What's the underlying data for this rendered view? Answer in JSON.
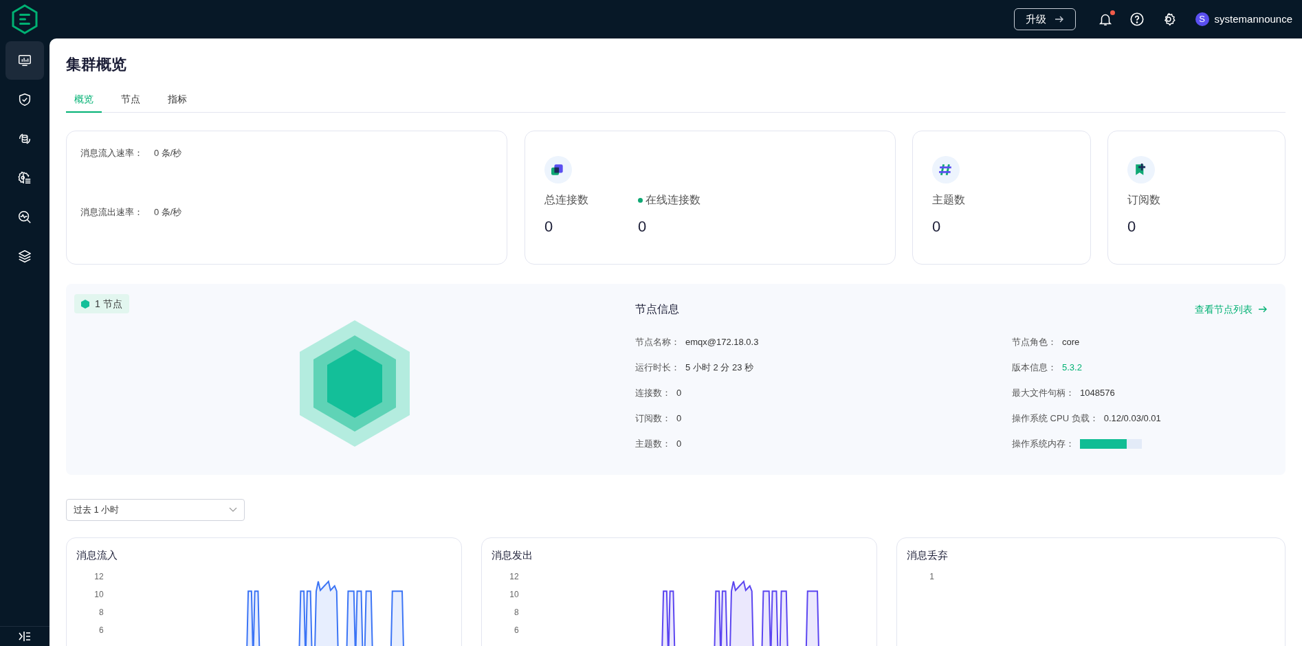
{
  "top_bar": {
    "upgrade_button": "升级",
    "notifications": {
      "unread": true
    },
    "user": {
      "avatar": "S",
      "name": "systemannounce"
    }
  },
  "sidebar": {
    "items": [
      {
        "kind": "monitor",
        "selected": true
      },
      {
        "kind": "shield",
        "selected": false
      },
      {
        "kind": "data",
        "selected": false
      },
      {
        "kind": "gear",
        "selected": false
      },
      {
        "kind": "analysis",
        "selected": false
      },
      {
        "kind": "layers",
        "selected": false
      }
    ]
  },
  "page_title": "集群概览",
  "tabs": [
    {
      "label": "概览",
      "selected": true
    },
    {
      "label": "节点",
      "selected": false
    },
    {
      "label": "指标",
      "selected": false
    }
  ],
  "rates": [
    {
      "label": "消息流入速率：",
      "value": "0 条/秒"
    },
    {
      "label": "消息流出速率：",
      "value": "0 条/秒"
    }
  ],
  "stat_cards": [
    {
      "kind": "connections",
      "metrics": [
        {
          "label": "总连接数",
          "value": "0",
          "dot": false
        },
        {
          "label": "在线连接数",
          "value": "0",
          "dot": true
        }
      ]
    },
    {
      "kind": "topics",
      "metrics": [
        {
          "label": "主题数",
          "value": "0",
          "dot": false
        }
      ]
    },
    {
      "kind": "subscriptions",
      "metrics": [
        {
          "label": "订阅数",
          "value": "0",
          "dot": false
        }
      ]
    }
  ],
  "node_panel": {
    "badge": "1 节点",
    "title": "节点信息",
    "link": "查看节点列表",
    "left_fields": [
      {
        "kind": "text",
        "label": "节点名称：",
        "value": "emqx@172.18.0.3"
      },
      {
        "kind": "text",
        "label": "运行时长：",
        "value": "5 小时 2 分 23 秒"
      },
      {
        "kind": "text",
        "label": "连接数：",
        "value": "0"
      },
      {
        "kind": "text",
        "label": "订阅数：",
        "value": "0"
      },
      {
        "kind": "text",
        "label": "主题数：",
        "value": "0"
      }
    ],
    "right_fields": [
      {
        "kind": "text",
        "label": "节点角色：",
        "value": "core"
      },
      {
        "kind": "version",
        "label": "版本信息：",
        "value": "5.3.2"
      },
      {
        "kind": "text",
        "label": "最大文件句柄：",
        "value": "1048576"
      },
      {
        "kind": "text",
        "label": "操作系统 CPU 负载：",
        "value": "0.12/0.03/0.01"
      },
      {
        "kind": "meter",
        "label": "操作系统内存：",
        "level": 0.76
      }
    ]
  },
  "time_range": {
    "value": "过去 1 小时"
  },
  "charts": [
    {
      "title": "消息流入",
      "y_ticks": [
        "12",
        "10",
        "8",
        "6"
      ],
      "color": "#3b74f5"
    },
    {
      "title": "消息发出",
      "y_ticks": [
        "12",
        "10",
        "8",
        "6"
      ],
      "color": "#5b45f0"
    },
    {
      "title": "消息丢弃",
      "y_ticks": [
        "1"
      ]
    }
  ]
}
